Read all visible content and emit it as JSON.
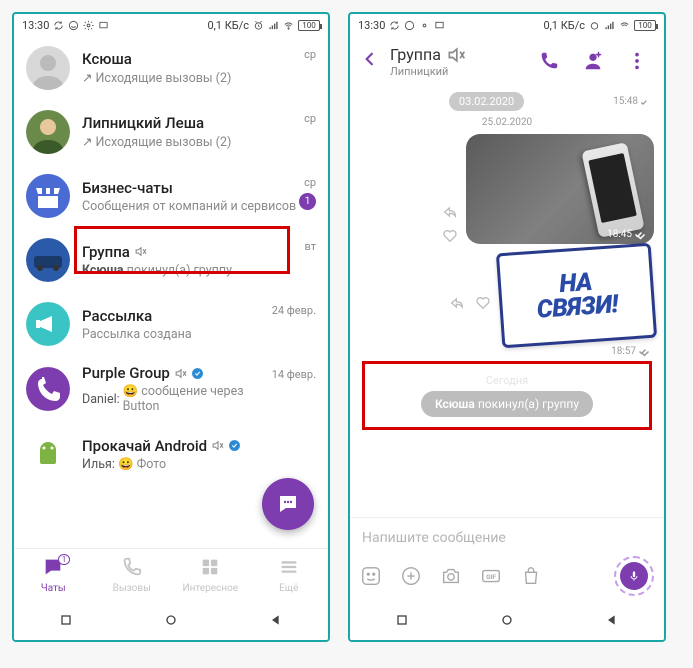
{
  "status": {
    "time": "13:30",
    "net": "0,1 КБ/с",
    "battery": "100"
  },
  "left": {
    "chats": [
      {
        "title": "Ксюша",
        "sub_prefix": "↗",
        "sub": "Исходящие вызовы (2)",
        "meta": "ср",
        "avatar": "person1"
      },
      {
        "title": "Липницкий Леша",
        "sub_prefix": "↗",
        "sub": "Исходящие вызовы (2)",
        "meta": "ср",
        "avatar": "person2"
      },
      {
        "title": "Бизнес-чаты",
        "sub": "Сообщения от компаний и сервисов",
        "meta": "ср",
        "badge": "1",
        "avatar": "shop"
      },
      {
        "title": "Группа",
        "muted": true,
        "sub_bold": "Ксюша",
        "sub_rest": " покинул(а) группу",
        "meta": "вт",
        "avatar": "car",
        "highlight": true
      },
      {
        "title": "Рассылка",
        "sub": "Рассылка создана",
        "meta": "24 февр.",
        "avatar": "megaphone"
      },
      {
        "title": "Purple Group",
        "muted": true,
        "verified": true,
        "sub_author": "Daniel:",
        "sub_emoji": "😀",
        "sub_rest": " сообщение через Button",
        "meta": "14 февр.",
        "avatar": "viber"
      },
      {
        "title": "Прокачай Android",
        "muted": true,
        "verified": true,
        "sub_author": "Илья:",
        "sub_emoji": "😀",
        "sub_rest": " Фото",
        "avatar": "android"
      }
    ],
    "tabs": [
      {
        "label": "Чаты",
        "badge": "1"
      },
      {
        "label": "Вызовы"
      },
      {
        "label": "Интересное"
      },
      {
        "label": "Ещё"
      }
    ]
  },
  "right": {
    "header": {
      "title": "Группа",
      "subtitle": "Липницкий"
    },
    "prev_time": "15:48",
    "date_pill": "03.02.2020",
    "date_small": "25.02.2020",
    "photo_time": "18:45",
    "sticker_line1": "НА",
    "sticker_line2": "СВЯЗИ!",
    "sticker_time": "18:57",
    "today": "Сегодня",
    "event_bold": "Ксюша",
    "event_rest": " покинул(а) группу",
    "compose_placeholder": "Напишите сообщение"
  }
}
